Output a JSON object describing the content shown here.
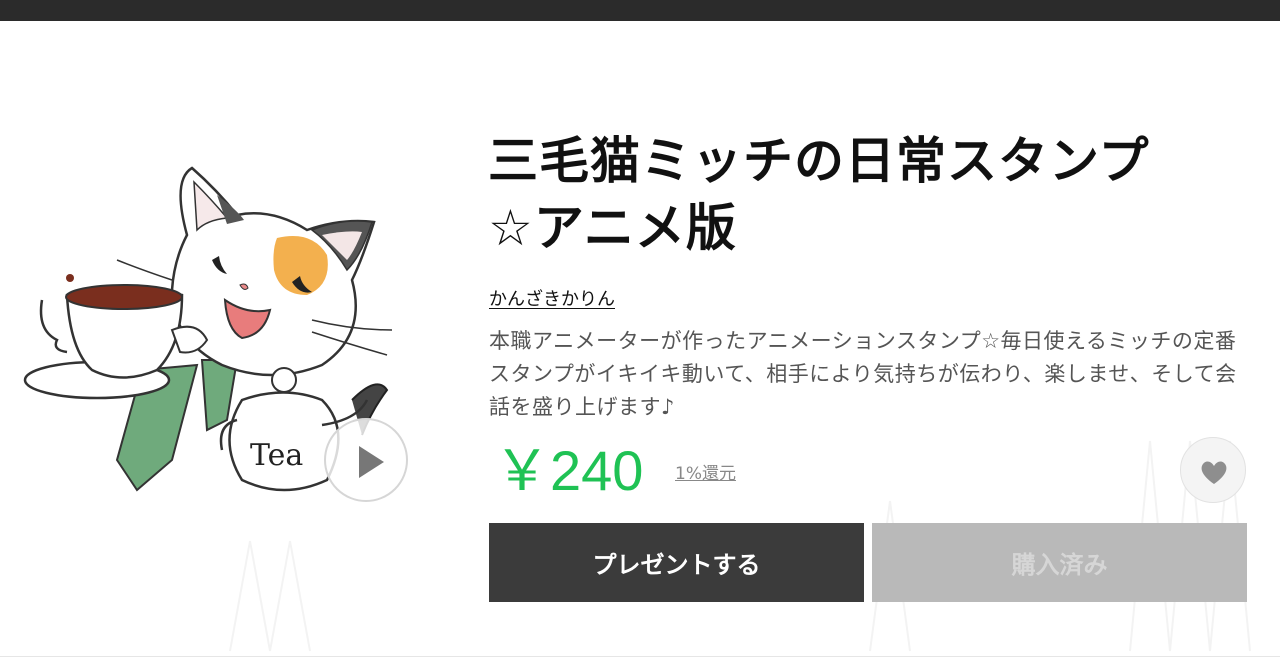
{
  "product": {
    "title_line1": "三毛猫ミッチの日常スタンプ",
    "title_line2": "☆アニメ版",
    "author": "かんざきかりん",
    "description": "本職アニメーターが作ったアニメーションスタンプ☆毎日使えるミッチの定番スタンプがイキイキ動いて、相手により気持ちが伝わり、楽しませ、そして会話を盛り上げます♪",
    "price": "￥240",
    "cashback": "1%還元",
    "sticker_text": "Tea"
  },
  "actions": {
    "present_label": "プレゼントする",
    "owned_label": "購入済み"
  },
  "icons": {
    "play": "play-icon",
    "favorite": "heart-icon"
  },
  "colors": {
    "price": "#1fc254",
    "topbar": "#2b2b2b",
    "present_button": "#3b3b3b",
    "owned_button": "#b9b9b9"
  }
}
